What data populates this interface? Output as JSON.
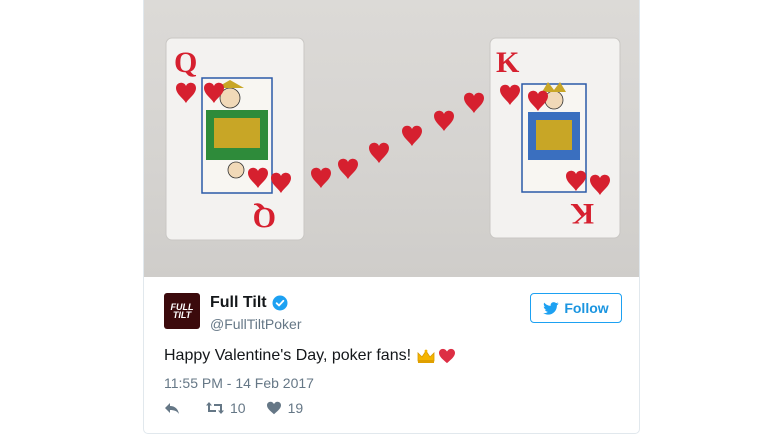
{
  "tweet": {
    "display_name": "Full Tilt",
    "handle": "@FullTiltPoker",
    "text": "Happy Valentine's Day, poker fans!",
    "timestamp": "11:55 PM - 14 Feb 2017",
    "retweets": "10",
    "likes": "19",
    "follow_label": "Follow",
    "avatar_text": "FULL TILT"
  },
  "media": {
    "left_card": {
      "rank": "Q",
      "suit": "heart-icon"
    },
    "right_card": {
      "rank": "K",
      "suit": "heart-icon"
    }
  },
  "icons": {
    "verified": "verified-badge-icon",
    "follow": "twitter-bird-icon",
    "reply": "reply-icon",
    "retweet": "retweet-icon",
    "like": "heart-icon",
    "emoji_1": "crown-emoji",
    "emoji_2": "red-heart-emoji"
  },
  "colors": {
    "accent": "#1da1f2",
    "card_red": "#d6202f",
    "avatar_bg": "#3b0a0c"
  }
}
